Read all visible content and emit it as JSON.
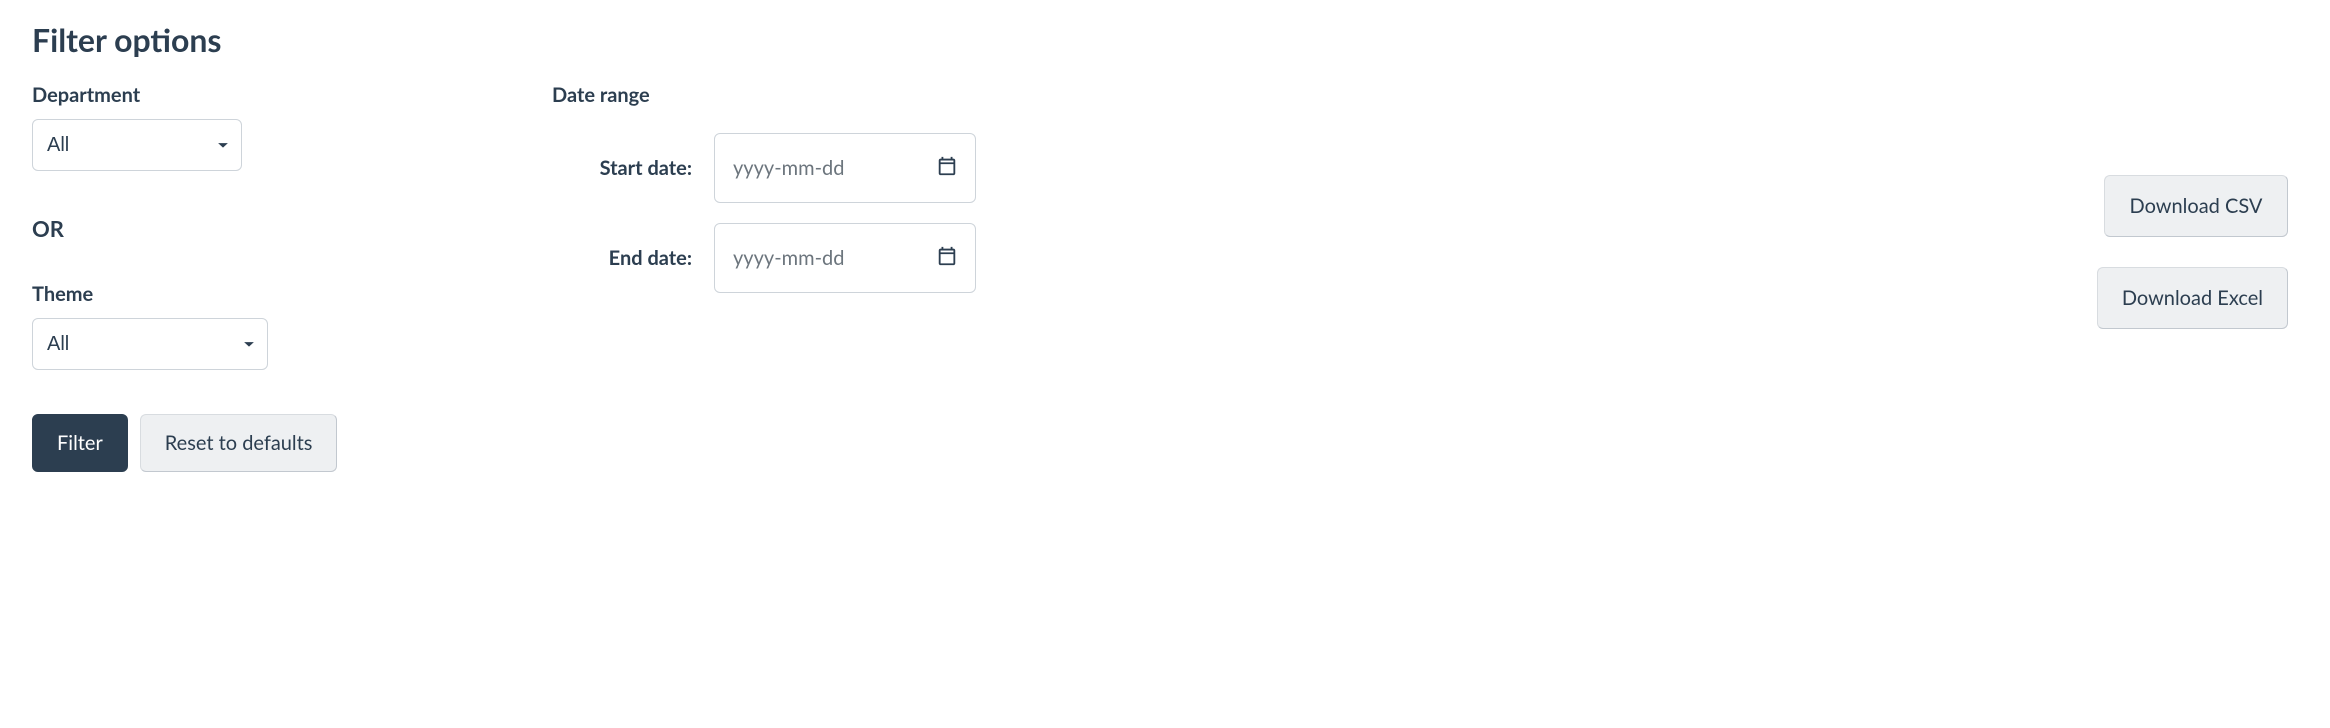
{
  "title": "Filter options",
  "left": {
    "department_label": "Department",
    "department_value": "All",
    "or_label": "OR",
    "theme_label": "Theme",
    "theme_value": "All"
  },
  "buttons": {
    "filter": "Filter",
    "reset": "Reset to defaults"
  },
  "range": {
    "heading": "Date range",
    "start_label": "Start date:",
    "start_placeholder": "yyyy-mm-dd",
    "end_label": "End date:",
    "end_placeholder": "yyyy-mm-dd"
  },
  "downloads": {
    "csv": "Download CSV",
    "excel": "Download Excel"
  }
}
